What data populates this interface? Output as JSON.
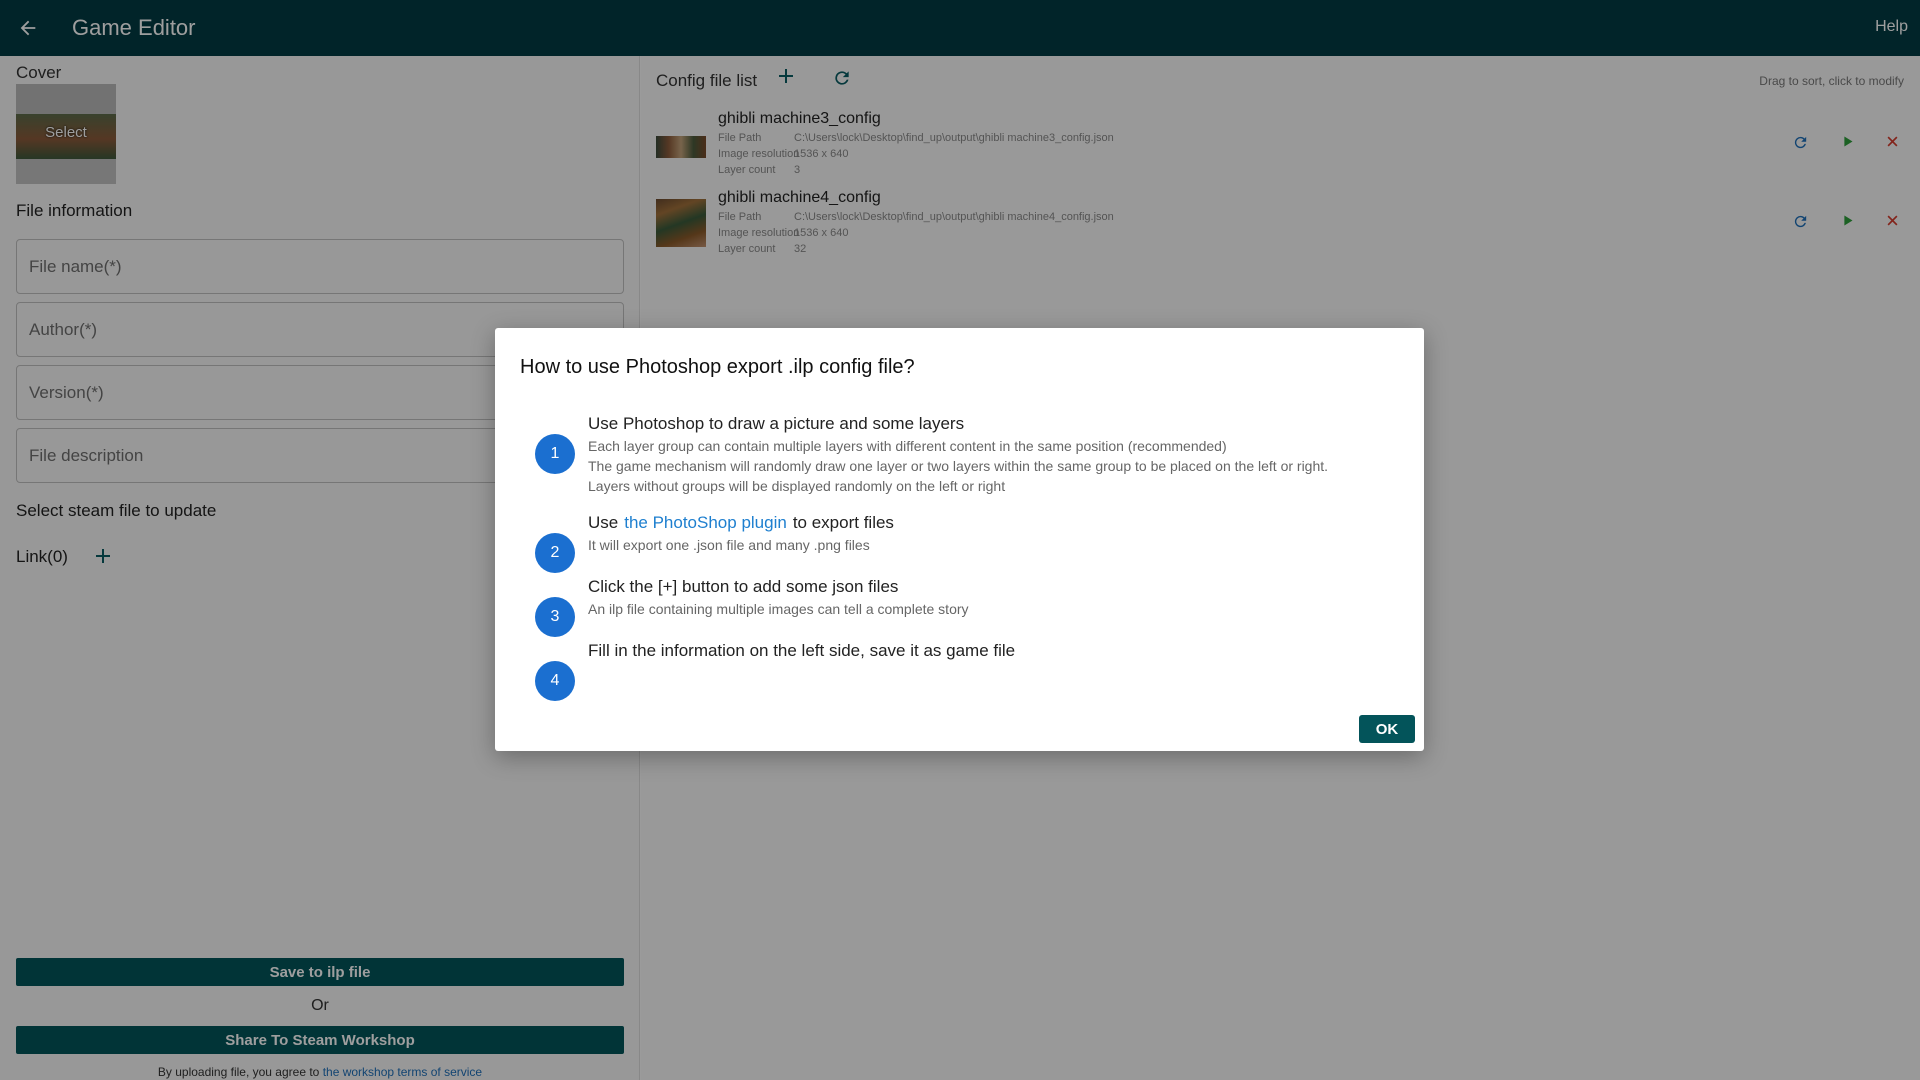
{
  "app": {
    "title": "Game Editor",
    "help": "Help"
  },
  "left": {
    "cover_label": "Cover",
    "cover_select": "Select",
    "file_info_label": "File information",
    "fields": {
      "file_name": "File name(*)",
      "author": "Author(*)",
      "version": "Version(*)",
      "description": "File description"
    },
    "steam_label": "Select steam file to update",
    "link_label": "Link(0)",
    "save_button": "Save to ilp file",
    "or": "Or",
    "share_button": "Share To Steam Workshop",
    "terms_prefix": "By uploading file, you agree to",
    "terms_link": "the workshop terms of service"
  },
  "right": {
    "title": "Config file list",
    "hint": "Drag to sort, click to modify",
    "row_labels": {
      "path": "File Path",
      "resolution": "Image resolution",
      "layers": "Layer count"
    },
    "items": [
      {
        "name": "ghibli machine3_config",
        "path": "C:\\Users\\lock\\Desktop\\find_up\\output\\ghibli machine3_config.json",
        "resolution": "1536 x 640",
        "layers": "3"
      },
      {
        "name": "ghibli machine4_config",
        "path": "C:\\Users\\lock\\Desktop\\find_up\\output\\ghibli machine4_config.json",
        "resolution": "1536 x 640",
        "layers": "32"
      }
    ]
  },
  "dialog": {
    "title": "How to use Photoshop export .ilp config file?",
    "steps": [
      {
        "num": "1",
        "main": "Use Photoshop to draw a picture and some layers",
        "sub": [
          "Each layer group can contain multiple layers with different content in the same position (recommended)",
          "The game mechanism will randomly draw one layer or two layers within the same group to be placed on the left or right.",
          "Layers without groups will be displayed randomly on the left or right"
        ]
      },
      {
        "num": "2",
        "main_prefix": "Use",
        "link": "the PhotoShop plugin",
        "main_suffix": "to export files",
        "sub": [
          "It will export one .json file and many .png files"
        ]
      },
      {
        "num": "3",
        "main": "Click the [+] button to add some json files",
        "sub": [
          "An ilp file containing multiple images can tell a complete story"
        ]
      },
      {
        "num": "4",
        "main": "Fill in the information on the left side, save it as game file",
        "sub": []
      }
    ],
    "ok": "OK"
  },
  "colors": {
    "topbar": "#023b43",
    "primary_button": "#03545a",
    "step_circle": "#1b6fd0",
    "link": "#1e7fcf",
    "play": "#2e9d3a",
    "delete": "#d33a2c",
    "refresh": "#1e6fb8"
  },
  "icons": [
    "back-arrow-icon",
    "add-icon",
    "refresh-icon",
    "play-icon",
    "close-icon"
  ]
}
